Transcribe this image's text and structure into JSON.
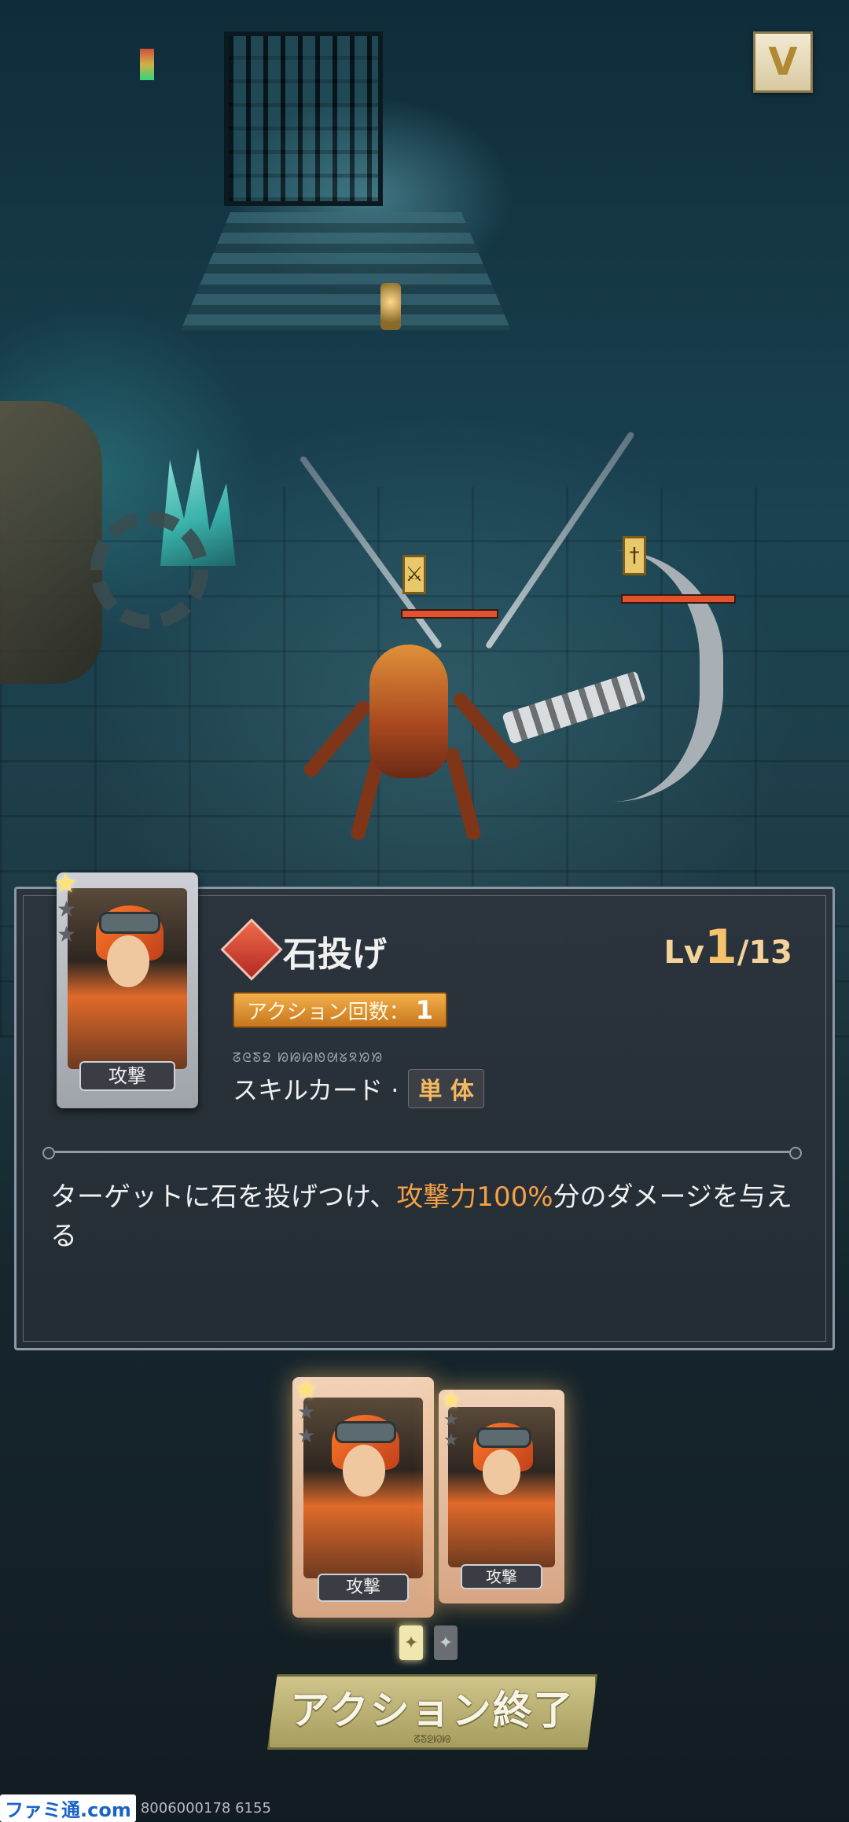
{
  "hud": {
    "menu_icon": "chevron-down-icon",
    "menu_glyph": "V"
  },
  "enemies": [
    {
      "name": "mechanical-insect",
      "marker_icon": "crossed-swords-icon",
      "marker_glyph": "⚔",
      "hp_color": "#e0532e"
    },
    {
      "name": "scythe-creature",
      "marker_icon": "sword-icon",
      "marker_glyph": "†",
      "hp_color": "#e0532e"
    }
  ],
  "detail": {
    "skill_icon": "skill-diamond-icon",
    "skill_name": "石投げ",
    "level_prefix": "Lv",
    "level_current": "1",
    "level_max": "/13",
    "action_label": "アクション回数：",
    "action_count": "1",
    "rune_text": "ᘔᘓᘕᘖ ᘗᘘᘙᘚᘛᘜᘝᘞᘟ",
    "type_label": "スキルカード ·",
    "target_label": "単 体",
    "description_before": "ターゲットに石を投げつけ、",
    "description_highlight": "攻撃力100%",
    "description_after": "分のダメージを与える",
    "card": {
      "label": "攻撃",
      "stars_filled": 1,
      "stars_total": 3
    }
  },
  "hand": [
    {
      "label": "攻撃",
      "stars_filled": 1,
      "stars_total": 3
    },
    {
      "label": "攻撃",
      "stars_filled": 1,
      "stars_total": 3
    }
  ],
  "slots": [
    {
      "icon": "sword-slot-icon",
      "glyph": "✦"
    },
    {
      "icon": "sword-slot-icon-empty",
      "glyph": "✦"
    }
  ],
  "end_button": {
    "label": "アクション終了",
    "sublabel": "ᘔᘕᘖᘗᘘ"
  },
  "watermark": {
    "logo": "ファミ通.com",
    "code": "8006000178 6155"
  },
  "colors": {
    "accent": "#f4a046",
    "hp": "#e0532e",
    "panel": "#2c343c",
    "button": "#cfc48a"
  }
}
